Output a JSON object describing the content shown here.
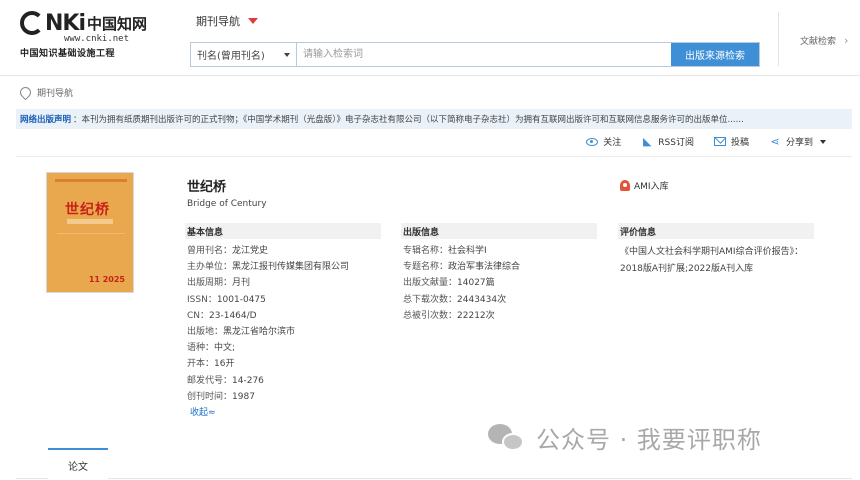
{
  "header": {
    "logo_brand": "CNKi中国知网",
    "logo_url": "www.cnki.net",
    "logo_project": "中国知识基础设施工程",
    "nav_title": "期刊导航",
    "search_field": "刊名(曾用刊名)",
    "search_placeholder": "请输入检索词",
    "search_button": "出版来源检索",
    "doc_search": "文献检索"
  },
  "breadcrumb": "期刊导航",
  "declaration": {
    "label": "网络出版声明",
    "text": "：本刊为拥有纸质期刊出版许可的正式刊物；《中国学术期刊（光盘版）》电子杂志社有限公司（以下简称电子杂志社）为拥有互联网出版许可和互联网信息服务许可的出版单位......"
  },
  "actions": {
    "follow": "关注",
    "rss": "RSS订阅",
    "submit": "投稿",
    "share": "分享到"
  },
  "cover": {
    "title": "世纪桥",
    "issue": "11 2025"
  },
  "journal": {
    "title": "世纪桥",
    "english_title": "Bridge of Century",
    "ami": "AMI入库"
  },
  "basic": {
    "heading": "基本信息",
    "former_name": {
      "k": "曾用刊名：",
      "v": "龙江党史"
    },
    "sponsor": {
      "k": "主办单位：",
      "v": "黑龙江报刊传媒集团有限公司"
    },
    "period": {
      "k": "出版周期：",
      "v": "月刊"
    },
    "issn": {
      "k": "ISSN：",
      "v": "1001-0475"
    },
    "cn": {
      "k": "CN：",
      "v": "23-1464/D"
    },
    "place": {
      "k": "出版地：",
      "v": "黑龙江省哈尔滨市"
    },
    "language": {
      "k": "语种：",
      "v": "中文;"
    },
    "format": {
      "k": "开本：",
      "v": "16开"
    },
    "postal": {
      "k": "邮发代号：",
      "v": "14-276"
    },
    "founded": {
      "k": "创刊时间：",
      "v": "1987"
    },
    "collapse": "收起≈"
  },
  "publishing": {
    "heading": "出版信息",
    "series": {
      "k": "专辑名称：",
      "v": "社会科学I"
    },
    "topic": {
      "k": "专题名称：",
      "v": "政治军事法律综合"
    },
    "count": {
      "k": "出版文献量：",
      "v": "14027篇"
    },
    "downloads": {
      "k": "总下载次数：",
      "v": "2443434次"
    },
    "citations": {
      "k": "总被引次数：",
      "v": "22212次"
    }
  },
  "evaluation": {
    "heading": "评价信息",
    "text": "《中国人文社会科学期刊AMI综合评价报告》：2018版A刊扩展;2022版A刊入库"
  },
  "tabs": {
    "papers": "论文"
  },
  "watermark": "公众号 · 我要评职称"
}
